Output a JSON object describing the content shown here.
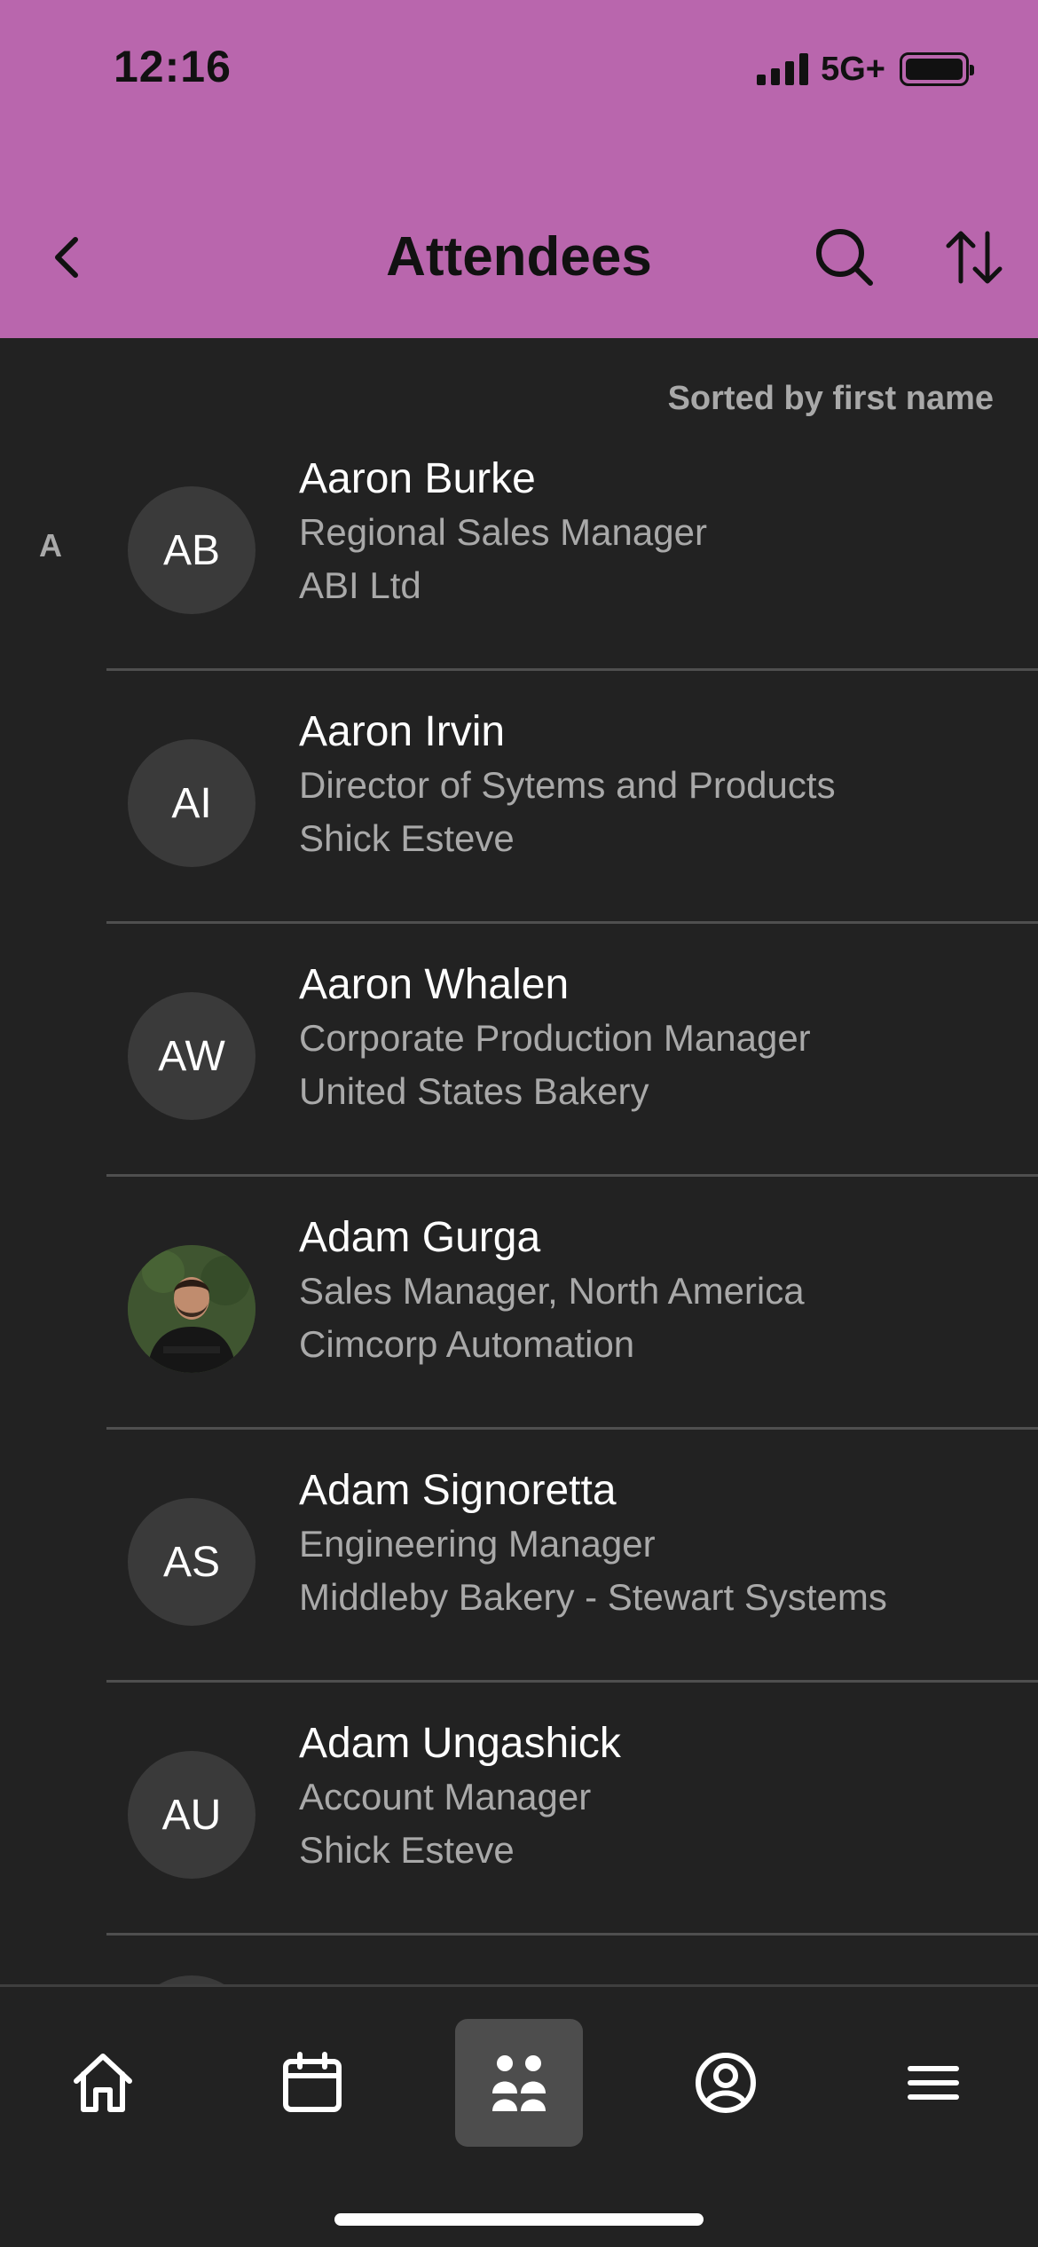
{
  "status_bar": {
    "time": "12:16",
    "network": "5G+"
  },
  "header": {
    "title": "Attendees",
    "back_icon": "chevron-left-icon",
    "search_icon": "search-icon",
    "sort_icon": "sort-arrows-icon",
    "background_color": "#b966ad"
  },
  "list": {
    "sorted_label": "Sorted by first name",
    "section_letter": "A",
    "attendees": [
      {
        "initials": "AB",
        "name": "Aaron Burke",
        "title": "Regional Sales Manager",
        "company": "ABI Ltd"
      },
      {
        "initials": "AI",
        "name": "Aaron Irvin",
        "title": "Director of Sytems and Products",
        "company": "Shick Esteve"
      },
      {
        "initials": "AW",
        "name": "Aaron Whalen",
        "title": "Corporate Production Manager",
        "company": "United States Bakery"
      },
      {
        "initials": "",
        "name": "Adam Gurga",
        "title": "Sales Manager, North America",
        "company": "Cimcorp Automation",
        "photo": true
      },
      {
        "initials": "AS",
        "name": "Adam Signoretta",
        "title": "Engineering Manager",
        "company": "Middleby Bakery - Stewart Systems"
      },
      {
        "initials": "AU",
        "name": "Adam Ungashick",
        "title": "Account Manager",
        "company": "Shick Esteve"
      }
    ]
  },
  "tabbar": {
    "tabs": [
      {
        "name": "home",
        "icon": "home-icon",
        "active": false
      },
      {
        "name": "calendar",
        "icon": "calendar-icon",
        "active": false
      },
      {
        "name": "attendees",
        "icon": "people-icon",
        "active": true
      },
      {
        "name": "profile",
        "icon": "user-circle-icon",
        "active": false
      },
      {
        "name": "menu",
        "icon": "hamburger-icon",
        "active": false
      }
    ]
  }
}
